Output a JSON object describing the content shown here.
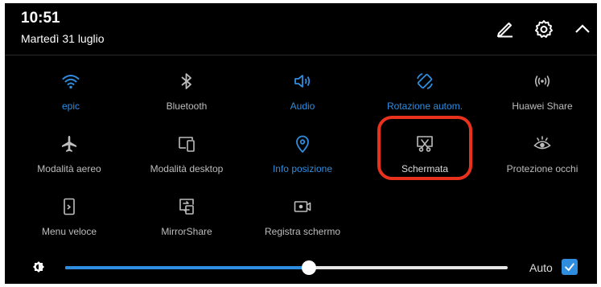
{
  "status": {
    "time": "10:51",
    "date": "Martedì 31 luglio"
  },
  "header_icons": [
    {
      "name": "edit-icon"
    },
    {
      "name": "gear-icon"
    },
    {
      "name": "chevron-up-icon"
    }
  ],
  "colors": {
    "accent": "#2f8de0",
    "inactive": "#bdbdbd",
    "highlight": "#e8321e",
    "background": "#000000"
  },
  "tiles": [
    {
      "label": "epic",
      "icon": "wifi-icon",
      "active": true
    },
    {
      "label": "Bluetooth",
      "icon": "bluetooth-icon",
      "active": false
    },
    {
      "label": "Audio",
      "icon": "speaker-icon",
      "active": true
    },
    {
      "label": "Rotazione autom.",
      "icon": "auto-rotate-icon",
      "active": true
    },
    {
      "label": "Huawei Share",
      "icon": "huawei-share-icon",
      "active": false
    },
    {
      "label": "Modalità aereo",
      "icon": "airplane-icon",
      "active": false
    },
    {
      "label": "Modalità desktop",
      "icon": "desktop-mode-icon",
      "active": false
    },
    {
      "label": "Info posizione",
      "icon": "location-icon",
      "active": true
    },
    {
      "label": "Schermata",
      "icon": "screenshot-icon",
      "active": false
    },
    {
      "label": "Protezione occhi",
      "icon": "eye-icon",
      "active": false
    },
    {
      "label": "Menu veloce",
      "icon": "quick-menu-icon",
      "active": false
    },
    {
      "label": "MirrorShare",
      "icon": "mirrorshare-icon",
      "active": false
    },
    {
      "label": "Registra schermo",
      "icon": "screen-record-icon",
      "active": false
    }
  ],
  "brightness": {
    "level": 0.55,
    "auto_label": "Auto",
    "auto_checked": true
  }
}
